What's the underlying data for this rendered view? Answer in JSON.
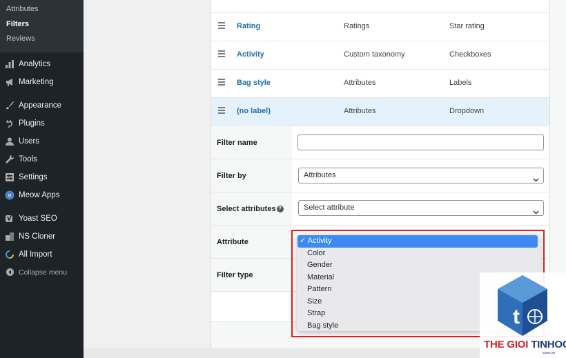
{
  "sidebar": {
    "submenu": [
      {
        "label": "Attributes",
        "active": false
      },
      {
        "label": "Filters",
        "active": true
      },
      {
        "label": "Reviews",
        "active": false
      }
    ],
    "menu": [
      {
        "label": "Analytics",
        "icon": "bar-chart-icon"
      },
      {
        "label": "Marketing",
        "icon": "megaphone-icon"
      },
      {
        "label": "Appearance",
        "icon": "paintbrush-icon"
      },
      {
        "label": "Plugins",
        "icon": "plug-icon"
      },
      {
        "label": "Users",
        "icon": "user-icon"
      },
      {
        "label": "Tools",
        "icon": "wrench-icon"
      },
      {
        "label": "Settings",
        "icon": "sliders-icon"
      },
      {
        "label": "Meow Apps",
        "icon": "meow-icon"
      },
      {
        "label": "Yoast SEO",
        "icon": "yoast-icon"
      },
      {
        "label": "NS Cloner",
        "icon": "cloner-icon"
      },
      {
        "label": "All Import",
        "icon": "import-icon"
      },
      {
        "label": "Collapse menu",
        "icon": "collapse-icon"
      }
    ]
  },
  "filters": [
    {
      "name": "Rating",
      "source": "Ratings",
      "type": "Star rating"
    },
    {
      "name": "Activity",
      "source": "Custom taxonomy",
      "type": "Checkboxes"
    },
    {
      "name": "Bag style",
      "source": "Attributes",
      "type": "Labels"
    },
    {
      "name": "(no label)",
      "source": "Attributes",
      "type": "Dropdown"
    }
  ],
  "form": {
    "filter_name_label": "Filter name",
    "filter_name_value": "",
    "filter_by_label": "Filter by",
    "filter_by_value": "Attributes",
    "select_attributes_label": "Select attributes",
    "select_attributes_help": "?",
    "select_attributes_value": "Select attribute",
    "attribute_label": "Attribute",
    "filter_type_label": "Filter type"
  },
  "attribute_dropdown": {
    "selected": "Activity",
    "check_mark": "✓",
    "options": [
      "Activity",
      "Color",
      "Gender",
      "Material",
      "Pattern",
      "Size",
      "Strap",
      "Bag style"
    ]
  },
  "watermark": {
    "brand_red": "THE GIOI ",
    "brand_dark": "TINHOC",
    "domain": ".com.vn"
  },
  "colors": {
    "sidebar_bg": "#1d2327",
    "link_blue": "#2271b1",
    "selected_option": "#3d8bf2",
    "highlight_red": "#e11d1d"
  }
}
